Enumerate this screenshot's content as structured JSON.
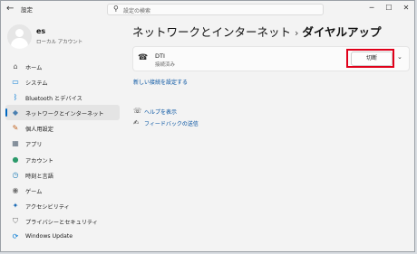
{
  "window": {
    "app_title": "設定",
    "back_icon": "back-arrow-icon",
    "minimize": "─",
    "maximize": "☐",
    "close": "✕"
  },
  "search": {
    "placeholder": "設定の検索",
    "icon": "search-icon"
  },
  "profile": {
    "name": "es",
    "subtitle": "ローカル アカウント"
  },
  "sidebar": {
    "items": [
      {
        "label": "ホーム",
        "icon": "home-icon",
        "glyph": "⌂",
        "color": "#555555"
      },
      {
        "label": "システム",
        "icon": "monitor-icon",
        "glyph": "▭",
        "color": "#0078d4"
      },
      {
        "label": "Bluetooth とデバイス",
        "icon": "bluetooth-icon",
        "glyph": "ᛒ",
        "color": "#0078d4"
      },
      {
        "label": "ネットワークとインターネット",
        "icon": "wifi-icon",
        "glyph": "◆",
        "color": "#4a7fb0",
        "active": true
      },
      {
        "label": "個人用設定",
        "icon": "brush-icon",
        "glyph": "✎",
        "color": "#c05f1a"
      },
      {
        "label": "アプリ",
        "icon": "apps-icon",
        "glyph": "▦",
        "color": "#5a6a7a"
      },
      {
        "label": "アカウント",
        "icon": "account-icon",
        "glyph": "●",
        "color": "#2c9a6b"
      },
      {
        "label": "時刻と言語",
        "icon": "clock-globe-icon",
        "glyph": "◷",
        "color": "#1a7ab5"
      },
      {
        "label": "ゲーム",
        "icon": "gamepad-icon",
        "glyph": "◉",
        "color": "#707070"
      },
      {
        "label": "アクセシビリティ",
        "icon": "accessibility-icon",
        "glyph": "✦",
        "color": "#1a6ab5"
      },
      {
        "label": "プライバシーとセキュリティ",
        "icon": "shield-icon",
        "glyph": "⛉",
        "color": "#6b6b6b"
      },
      {
        "label": "Windows Update",
        "icon": "windows-update-icon",
        "glyph": "⟳",
        "color": "#0078d4"
      }
    ]
  },
  "main": {
    "breadcrumb_parent": "ネットワークとインターネット",
    "breadcrumb_sep": "›",
    "breadcrumb_current": "ダイヤルアップ",
    "connection": {
      "name": "DTI",
      "status": "接続済み",
      "icon": "dialup-icon",
      "disconnect_label": "切断",
      "chevron": "⌄"
    },
    "new_connection_link": "新しい接続を設定する",
    "help_links": [
      {
        "label": "ヘルプを表示",
        "icon": "help-icon",
        "glyph": "☏"
      },
      {
        "label": "フィードバックの送信",
        "icon": "feedback-icon",
        "glyph": "✍"
      }
    ]
  },
  "colors": {
    "accent": "#0067c0",
    "highlight_box": "#e0001a"
  }
}
